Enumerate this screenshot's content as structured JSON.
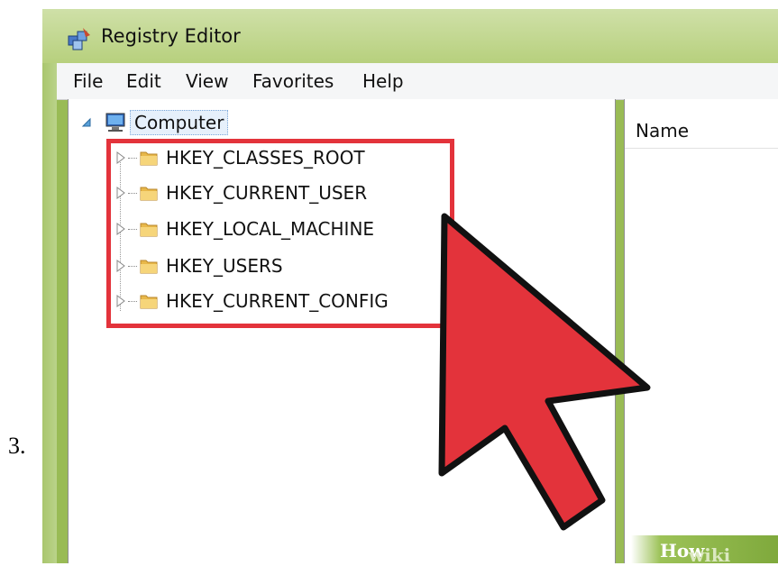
{
  "step_number": "3.",
  "window": {
    "title": "Registry Editor",
    "title_icon": "registry-editor-icon"
  },
  "menubar": {
    "items": [
      "File",
      "Edit",
      "View",
      "Favorites",
      "Help"
    ]
  },
  "tree": {
    "root": {
      "label": "Computer",
      "icon": "computer-icon",
      "expanded": true
    },
    "keys": [
      {
        "label": "HKEY_CLASSES_ROOT",
        "icon": "folder-icon"
      },
      {
        "label": "HKEY_CURRENT_USER",
        "icon": "folder-icon"
      },
      {
        "label": "HKEY_LOCAL_MACHINE",
        "icon": "folder-icon"
      },
      {
        "label": "HKEY_USERS",
        "icon": "folder-icon"
      },
      {
        "label": "HKEY_CURRENT_CONFIG",
        "icon": "folder-icon"
      }
    ]
  },
  "list": {
    "columns": [
      "Name"
    ]
  },
  "watermark": {
    "prefix": "wiki",
    "suffix": "How"
  },
  "colors": {
    "highlight": "#e3333b",
    "cursor": "#e3333b",
    "titlebar": "#b7d07d"
  }
}
